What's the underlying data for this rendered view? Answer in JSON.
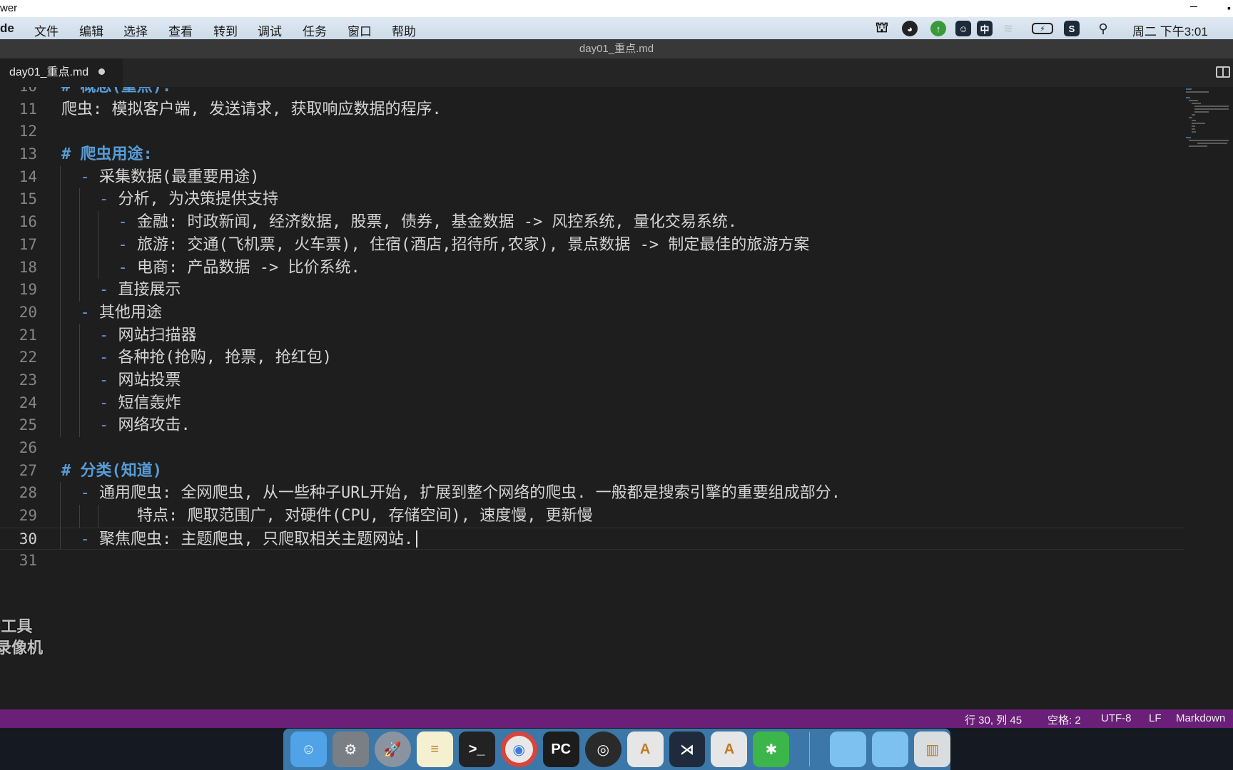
{
  "window": {
    "app_partial": "wer",
    "minimize": "–",
    "maximize": "▪"
  },
  "menubar": {
    "items": [
      "de",
      "文件",
      "编辑",
      "选择",
      "查看",
      "转到",
      "调试",
      "任务",
      "窗口",
      "帮助"
    ],
    "tray_icons": [
      "bookmark-icon",
      "bird-icon",
      "upload-icon",
      "emoji-icon",
      "input-method-icon",
      "wifi-icon",
      "battery-icon",
      "sogou-icon",
      "spotlight-search-icon"
    ],
    "input_method": "中",
    "clock": "周二 下午3:01"
  },
  "titlebar": {
    "title": "day01_重点.md"
  },
  "tab": {
    "label": "day01_重点.md",
    "dirty": true
  },
  "editor": {
    "lines": [
      {
        "n": "10",
        "indent": 0,
        "type": "h",
        "marker": "# ",
        "text": "概念(重点):"
      },
      {
        "n": "11",
        "indent": 0,
        "type": "p",
        "marker": "",
        "text": "爬虫: 模拟客户端, 发送请求, 获取响应数据的程序."
      },
      {
        "n": "12",
        "indent": 0,
        "type": "p",
        "marker": "",
        "text": ""
      },
      {
        "n": "13",
        "indent": 0,
        "type": "h",
        "marker": "# ",
        "text": "爬虫用途:"
      },
      {
        "n": "14",
        "indent": 2,
        "type": "li",
        "marker": "- ",
        "text": "采集数据(最重要用途)"
      },
      {
        "n": "15",
        "indent": 4,
        "type": "li",
        "marker": "- ",
        "text": "分析, 为决策提供支持"
      },
      {
        "n": "16",
        "indent": 6,
        "type": "li",
        "marker": "- ",
        "text": "金融: 时政新闻, 经济数据, 股票, 债券, 基金数据 -> 风控系统, 量化交易系统."
      },
      {
        "n": "17",
        "indent": 6,
        "type": "li",
        "marker": "- ",
        "text": "旅游: 交通(飞机票, 火车票), 住宿(酒店,招待所,农家), 景点数据 -> 制定最佳的旅游方案"
      },
      {
        "n": "18",
        "indent": 6,
        "type": "li",
        "marker": "- ",
        "text": "电商: 产品数据 -> 比价系统."
      },
      {
        "n": "19",
        "indent": 4,
        "type": "li",
        "marker": "- ",
        "text": "直接展示"
      },
      {
        "n": "20",
        "indent": 2,
        "type": "li",
        "marker": "- ",
        "text": "其他用途"
      },
      {
        "n": "21",
        "indent": 4,
        "type": "li",
        "marker": "- ",
        "text": "网站扫描器"
      },
      {
        "n": "22",
        "indent": 4,
        "type": "li",
        "marker": "- ",
        "text": "各种抢(抢购, 抢票, 抢红包)"
      },
      {
        "n": "23",
        "indent": 4,
        "type": "li",
        "marker": "- ",
        "text": "网站投票"
      },
      {
        "n": "24",
        "indent": 4,
        "type": "li",
        "marker": "- ",
        "text": "短信轰炸"
      },
      {
        "n": "25",
        "indent": 4,
        "type": "li",
        "marker": "- ",
        "text": "网络攻击."
      },
      {
        "n": "26",
        "indent": 0,
        "type": "p",
        "marker": "",
        "text": ""
      },
      {
        "n": "27",
        "indent": 0,
        "type": "h",
        "marker": "# ",
        "text": "分类(知道)"
      },
      {
        "n": "28",
        "indent": 2,
        "type": "li",
        "marker": "- ",
        "text": "通用爬虫: 全网爬虫, 从一些种子URL开始, 扩展到整个网络的爬虫. 一般都是搜索引擎的重要组成部分."
      },
      {
        "n": "29",
        "indent": 8,
        "type": "p",
        "marker": "",
        "text": "特点: 爬取范围广, 对硬件(CPU, 存储空间), 速度慢, 更新慢"
      },
      {
        "n": "30",
        "indent": 2,
        "type": "li",
        "marker": "- ",
        "text": "聚焦爬虫: 主题爬虫, 只爬取相关主题网站.",
        "active": true
      },
      {
        "n": "31",
        "indent": 0,
        "type": "p",
        "marker": "",
        "text": ""
      }
    ]
  },
  "overlay": {
    "line1": "]工具",
    "line2": "录像机"
  },
  "statusbar": {
    "position": "行 30, 列 45",
    "spaces": "空格: 2",
    "encoding": "UTF-8",
    "eol": "LF",
    "language": "Markdown",
    "color": "#6a1f78"
  },
  "dock": {
    "items": [
      "finder-icon",
      "system-preferences-icon",
      "launchpad-icon",
      "notes-icon",
      "terminal-icon",
      "chrome-icon",
      "pycharm-icon",
      "obs-icon",
      "document-icon",
      "vscode-icon",
      "document-icon",
      "xmind-icon",
      "downloads-folder-icon",
      "applications-folder-icon",
      "trash-icon"
    ]
  }
}
